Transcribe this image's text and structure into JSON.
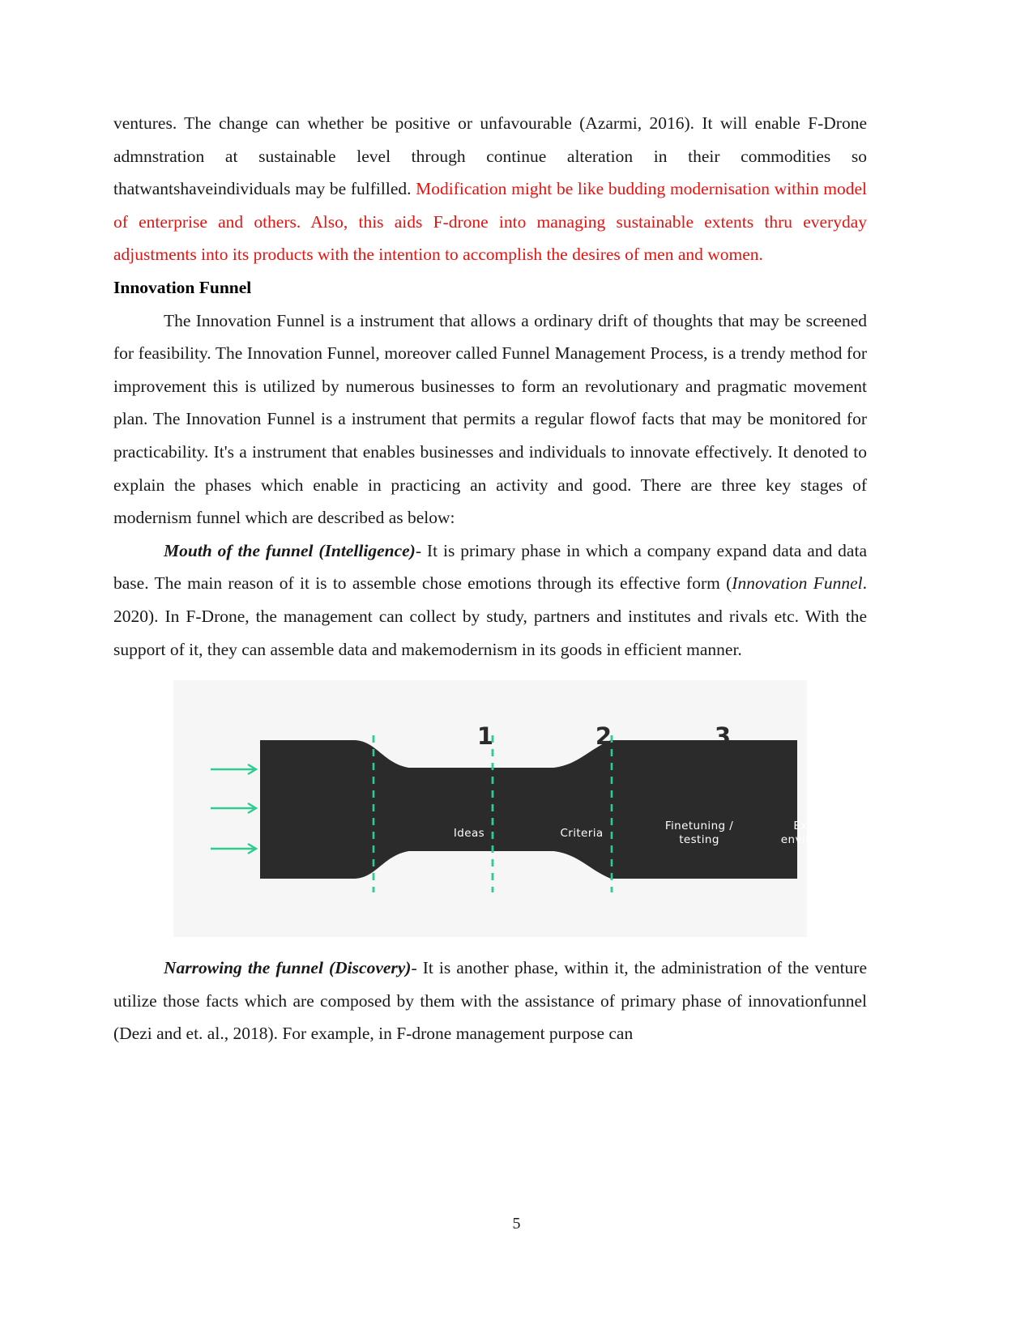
{
  "document": {
    "page_number": "5",
    "colors": {
      "body_text": "#1a1a1a",
      "highlight_red": "#e8120e",
      "figure_background": "#f5f6f5",
      "funnel_fill": "#2b2b2b",
      "arrow_green": "#2ecc8f",
      "divider_green": "#2ecc8f"
    },
    "paragraphs": {
      "p1_black_part": "ventures. The change can whether be positive or unfavourable (Azarmi, 2016). It will enable F-Drone admnstration at sustainable level through continue alteration in their commodities so thatwantshaveindividuals may be fulfilled. ",
      "p1_red_part": "Modification might be like budding modernisation within model of enterprise and others. Also, this aids F-drone into managing sustainable extents thru everyday adjustments into its products with the intention to accomplish the desires of men and women.",
      "heading_innovation_funnel": "Innovation Funnel",
      "p2": "The Innovation Funnel is a instrument that allows a ordinary drift of thoughts that may be screened for feasibility. The Innovation Funnel, moreover called Funnel Management Process, is a trendy method for improvement this is utilized by numerous businesses to form an revolutionary and pragmatic movement plan. The Innovation Funnel is a instrument that permits a regular flowof facts that may be monitored for practicability. It's a instrument that enables businesses and individuals to innovate effectively. It denoted to explain the phases which enable in practicing an activity and good. There are three key stages of modernism funnel which are described as below:",
      "p3_run_in": "Mouth of the funnel (Intelligence)",
      "p3_part1": "- It is primary phase in which a company expand data and data base. The main reason of it is to assemble chose emotions through its effective form (",
      "p3_italic": "Innovation Funnel",
      "p3_part2": ". 2020). In F-Drone, the management can collect by study, partners and institutes and rivals etc. With the support of it, they can assemble data and makemodernism in its goods in efficient manner.",
      "p4_run_in": "Narrowing the funnel (Discovery)",
      "p4_text": "- It is another phase, within it, the administration of the venture utilize those facts which are composed by them with the assistance of primary phase of innovationfunnel (Dezi and et. al., 2018). For example, in F-drone management purpose can"
    }
  },
  "figure": {
    "stage_numbers": [
      "1",
      "2",
      "3"
    ],
    "labels": [
      "Ideas",
      "Criteria",
      "Finetuning /\ntesting",
      "External\nenvironment"
    ],
    "label_ideas": "Ideas",
    "label_criteria": "Criteria",
    "label_finetuning_line1": "Finetuning /",
    "label_finetuning_line2": "testing",
    "label_external_line1": "External",
    "label_external_line2": "environment",
    "arrow_count": 3
  }
}
